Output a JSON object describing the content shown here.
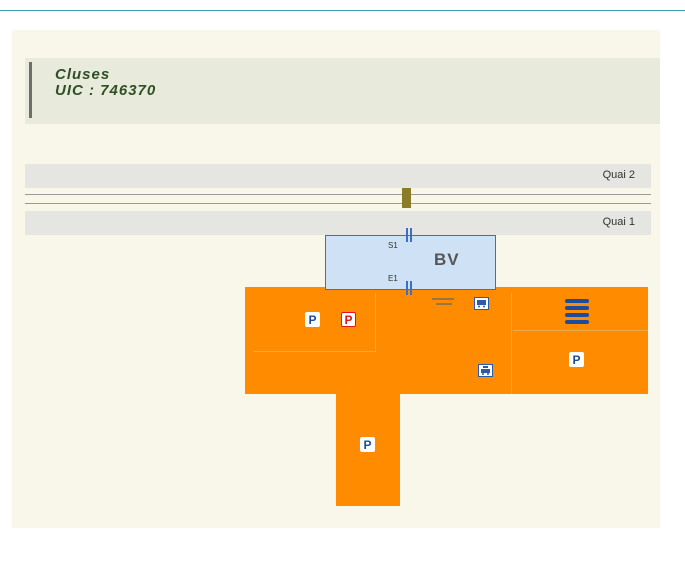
{
  "header": {
    "station_name": "Cluses",
    "uic_code": "UIC : 746370"
  },
  "platforms": {
    "quai2_label": "Quai 2",
    "quai1_label": "Quai 1"
  },
  "building": {
    "label": "BV",
    "door_exit": "S1",
    "door_entry": "E1"
  },
  "parking": {
    "p_label": "P",
    "p_reserved_label": "P"
  },
  "icons": {
    "bus": "bus-icon",
    "taxi": "taxi-icon",
    "bike_rack": "bike-rack-icon",
    "crossing": "level-crossing-marker"
  },
  "colors": {
    "forecourt": "#ff8c00",
    "building": "#cfe2f5",
    "platform": "#e5e5e2",
    "header_text": "#2f4f24",
    "reserved_parking": "#e0161c"
  }
}
